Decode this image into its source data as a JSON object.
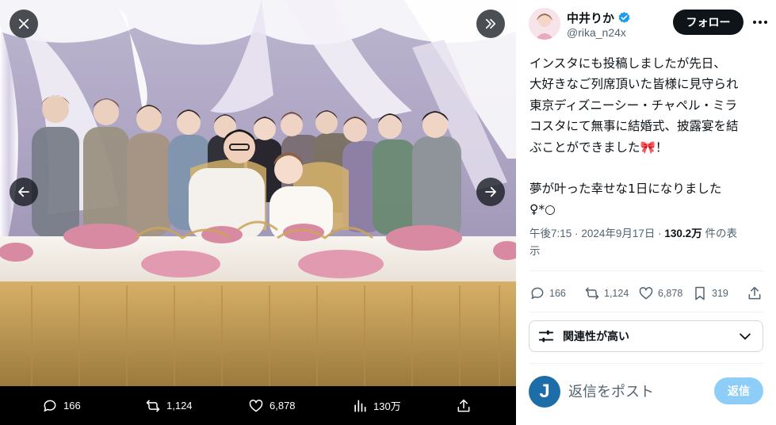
{
  "viewer": {
    "stats": {
      "replies": "166",
      "reposts": "1,124",
      "likes": "6,878",
      "views": "130万"
    }
  },
  "post": {
    "author": {
      "display_name": "中井りか",
      "handle": "@rika_n24x"
    },
    "follow_label": "フォロー",
    "text_lines": [
      "インスタにも投稿しましたが先日、",
      "大好きなご列席頂いた皆様に見守られ",
      "東京ディズニーシー・チャペル・ミラ",
      "コスタにて無事に結婚式、披露宴を結",
      "ぶことができました"
    ],
    "ribbon": "🎀",
    "text_line5_end": "！",
    "text_line6": "夢が叶った幸せな1日になりました",
    "text_line7": "♀*○",
    "meta": {
      "time": "午後7:15",
      "sep": "·",
      "date": "2024年9月17日",
      "views_count": "130.2万",
      "views_suffix": "件の表",
      "views_suffix2": "示"
    },
    "actions": {
      "replies": "166",
      "reposts": "1,124",
      "likes": "6,878",
      "bookmarks": "319"
    },
    "related_label": "関連性が高い",
    "reply": {
      "avatar_letter": "J",
      "placeholder": "返信をポスト",
      "button_label": "返信"
    }
  },
  "colors": {
    "accent": "#1d9bf0",
    "follow_bg": "#0f1419",
    "reply_button_bg": "#8ecdf7",
    "muted_text": "#536471"
  },
  "icons": {
    "close": "close-icon",
    "expand": "double-chevron-right-icon",
    "prev": "arrow-left-icon",
    "next": "arrow-right-icon",
    "reply": "speech-bubble-icon",
    "repost": "repost-icon",
    "like": "heart-icon",
    "views": "bar-chart-icon",
    "share": "share-icon",
    "bookmark": "bookmark-icon",
    "verified": "verified-badge-icon",
    "related": "sliders-icon",
    "chevron": "chevron-down-icon"
  }
}
